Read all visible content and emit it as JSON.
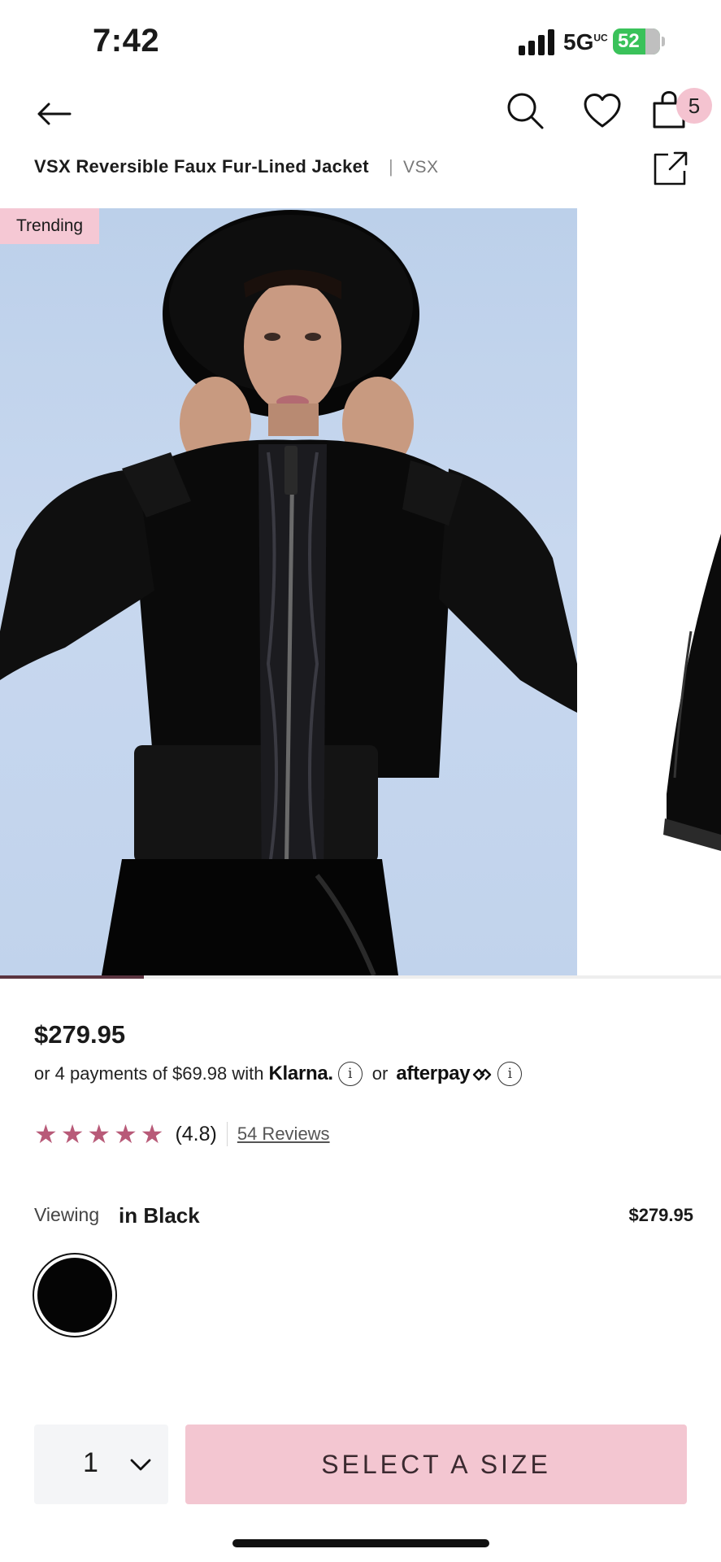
{
  "status_bar": {
    "time": "7:42",
    "network": "5G",
    "network_sup": "UC",
    "battery": "52"
  },
  "nav": {
    "back_icon": "arrow-left-icon",
    "search_icon": "search-icon",
    "wishlist_icon": "heart-icon",
    "bag_icon": "shopping-bag-icon",
    "bag_count": "5"
  },
  "product": {
    "title": "VSX Reversible Faux Fur-Lined Jacket",
    "separator": "|",
    "brand": "VSX",
    "share_icon": "share-icon",
    "badge": "Trending",
    "price": "$279.95",
    "payments": {
      "prefix": "or 4 payments of $69.98 with",
      "klarna": "Klarna.",
      "or": "or",
      "afterpay": "afterpay"
    },
    "rating": {
      "stars": 5,
      "value": "(4.8)",
      "reviews": "54 Reviews"
    },
    "viewing": {
      "label": "Viewing",
      "color": "in Black",
      "price": "$279.95"
    },
    "swatch_color": "#050505",
    "gallery_progress": 0.2
  },
  "purchase": {
    "quantity": "1",
    "cta": "SELECT A SIZE"
  },
  "colors": {
    "accent_pink": "#f3c6d1",
    "star": "#b85a78",
    "image_bg": "#c1d3ec"
  }
}
